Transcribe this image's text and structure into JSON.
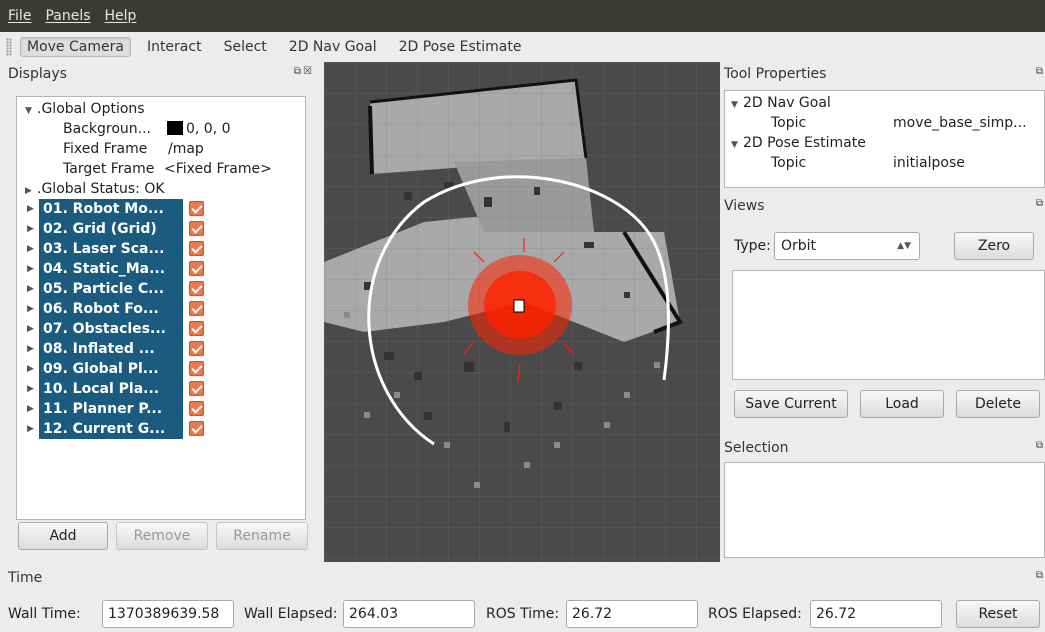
{
  "menu": [
    "File",
    "Panels",
    "Help"
  ],
  "toolbar": [
    "Move Camera",
    "Interact",
    "Select",
    "2D Nav Goal",
    "2D Pose Estimate"
  ],
  "displays": {
    "title": "Displays",
    "global_options": ".Global Options",
    "options": [
      {
        "label": "Backgroun...",
        "value": "0, 0, 0"
      },
      {
        "label": "Fixed Frame",
        "value": "/map"
      },
      {
        "label": "Target Frame",
        "value": "<Fixed Frame>"
      }
    ],
    "global_status": ".Global Status: OK",
    "items": [
      "01. Robot Mo...",
      "02. Grid (Grid)",
      "03. Laser Sca...",
      "04. Static_Ma...",
      "05. Particle C...",
      "06. Robot Fo...",
      "07. Obstacles...",
      "08. Inflated ...",
      "09. Global Pl...",
      "10. Local Pla...",
      "11. Planner P...",
      "12. Current G..."
    ],
    "buttons": {
      "add": "Add",
      "remove": "Remove",
      "rename": "Rename"
    }
  },
  "tool_properties": {
    "title": "Tool Properties",
    "nav_goal": "2D Nav Goal",
    "nav_goal_topic_label": "Topic",
    "nav_goal_topic_value": "move_base_simp...",
    "pose_estimate": "2D Pose Estimate",
    "pose_topic_label": "Topic",
    "pose_topic_value": "initialpose"
  },
  "views": {
    "title": "Views",
    "type_label": "Type:",
    "type_value": "Orbit",
    "zero": "Zero",
    "save_current": "Save Current",
    "load": "Load",
    "delete": "Delete"
  },
  "selection": {
    "title": "Selection"
  },
  "time": {
    "title": "Time",
    "wall_time_label": "Wall Time:",
    "wall_time": "1370389639.58",
    "wall_elapsed_label": "Wall Elapsed:",
    "wall_elapsed": "264.03",
    "ros_time_label": "ROS Time:",
    "ros_time": "26.72",
    "ros_elapsed_label": "ROS Elapsed:",
    "ros_elapsed": "26.72",
    "reset": "Reset"
  },
  "colors": {
    "menubar_bg": "#3b3a36",
    "selection_bg": "#1b5b80",
    "checkbox": "#f07746",
    "particles": "#ff2200",
    "map_free": "#a9a9a9",
    "map_unknown": "#4a4a4a"
  },
  "icons": {
    "dock": "float-close-icons",
    "checkbox": "checked-icon",
    "expand": "triangle-icon"
  }
}
